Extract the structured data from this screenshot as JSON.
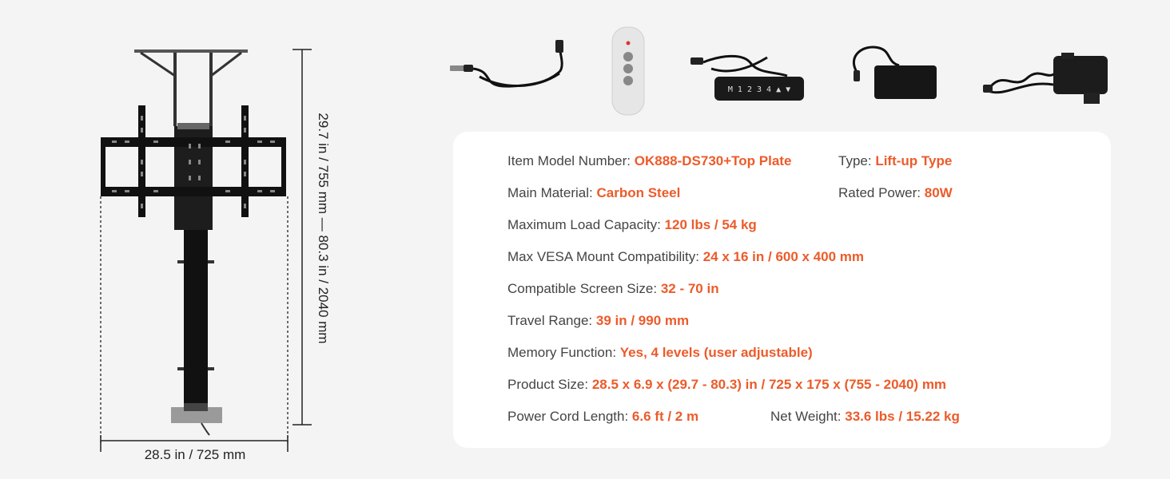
{
  "dimensions": {
    "width_label": "28.5 in / 725 mm",
    "height_label": "29.7 in / 755 mm  —  80.3 in / 2040 mm"
  },
  "accessories": [
    {
      "name": "usb-cable-icon"
    },
    {
      "name": "remote-control-icon"
    },
    {
      "name": "control-keypad-icon"
    },
    {
      "name": "power-adapter-icon"
    },
    {
      "name": "control-box-icon"
    }
  ],
  "keypad_text": "M 1 2 3 4 ▲ ▼",
  "specs": {
    "model": {
      "label": "Item Model Number: ",
      "value": "OK888-DS730+Top Plate"
    },
    "type": {
      "label": "Type: ",
      "value": "Lift-up Type"
    },
    "material": {
      "label": "Main Material: ",
      "value": "Carbon Steel"
    },
    "power": {
      "label": "Rated Power: ",
      "value": "80W"
    },
    "load": {
      "label": "Maximum Load Capacity: ",
      "value": "120 lbs / 54 kg"
    },
    "vesa": {
      "label": "Max VESA Mount Compatibility: ",
      "value": "24 x 16 in / 600 x 400 mm"
    },
    "screen": {
      "label": "Compatible Screen Size: ",
      "value": "32 - 70 in"
    },
    "travel": {
      "label": "Travel Range: ",
      "value": "39 in / 990 mm"
    },
    "memory": {
      "label": "Memory Function: ",
      "value": "Yes, 4 levels (user adjustable)"
    },
    "size": {
      "label": "Product Size: ",
      "value": "28.5 x 6.9 x (29.7 - 80.3) in / 725 x 175 x (755 - 2040) mm"
    },
    "cord": {
      "label": "Power Cord Length: ",
      "value": "6.6 ft / 2 m"
    },
    "weight": {
      "label": "Net Weight: ",
      "value": "33.6 lbs / 15.22 kg"
    }
  },
  "colors": {
    "accent": "#ec5b2a",
    "background": "#f4f4f4",
    "card": "#ffffff"
  }
}
